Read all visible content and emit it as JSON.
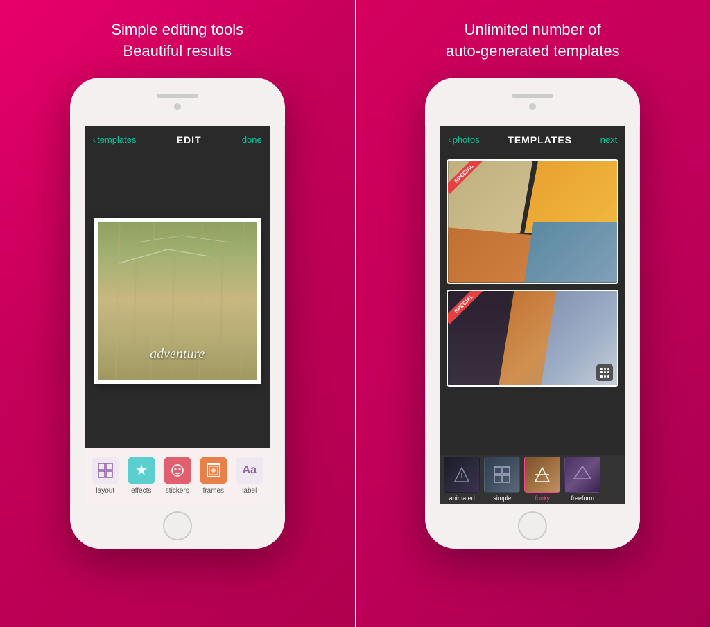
{
  "left": {
    "headline_line1": "Simple editing tools",
    "headline_line2": "Beautiful results",
    "nav": {
      "back_label": "templates",
      "title": "EDIT",
      "action": "done"
    },
    "photo_text": "adventure",
    "toolbar": {
      "items": [
        {
          "id": "layout",
          "label": "layout"
        },
        {
          "id": "effects",
          "label": "effects"
        },
        {
          "id": "stickers",
          "label": "stickers"
        },
        {
          "id": "frames",
          "label": "frames"
        },
        {
          "id": "label",
          "label": "label"
        }
      ]
    }
  },
  "right": {
    "headline_line1": "Unlimited number of",
    "headline_line2": "auto-generated templates",
    "nav": {
      "back_label": "photos",
      "title": "TEMPLATES",
      "action": "next"
    },
    "thumbnails": [
      {
        "id": "animated",
        "label": "animated"
      },
      {
        "id": "simple",
        "label": "simple"
      },
      {
        "id": "funky",
        "label": "funky",
        "selected": true
      },
      {
        "id": "freeform",
        "label": "freeform"
      }
    ],
    "badge_text": "SPECIAL"
  },
  "icons": {
    "chevron": "‹",
    "layout": "⊞",
    "effects": "✦",
    "stickers": "☺",
    "frames": "⬡",
    "label": "Aa",
    "grid": "⋯"
  }
}
